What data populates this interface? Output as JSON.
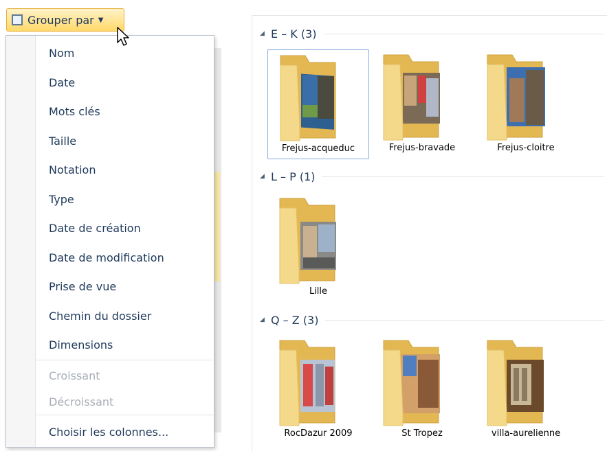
{
  "toolbar": {
    "group_by_label": "Grouper par",
    "group_by_icon": "group-by-icon",
    "dropdown_icon": "chevron-down-icon"
  },
  "menu": {
    "items": [
      {
        "label": "Nom",
        "enabled": true
      },
      {
        "label": "Date",
        "enabled": true
      },
      {
        "label": "Mots clés",
        "enabled": true
      },
      {
        "label": "Taille",
        "enabled": true
      },
      {
        "label": "Notation",
        "enabled": true
      },
      {
        "label": "Type",
        "enabled": true
      },
      {
        "label": "Date de création",
        "enabled": true
      },
      {
        "label": "Date de modification",
        "enabled": true
      },
      {
        "label": "Prise de vue",
        "enabled": true
      },
      {
        "label": "Chemin du dossier",
        "enabled": true
      },
      {
        "label": "Dimensions",
        "enabled": true
      }
    ],
    "order_items": [
      {
        "label": "Croissant",
        "enabled": false
      },
      {
        "label": "Décroissant",
        "enabled": false
      }
    ],
    "choose_columns": "Choisir les colonnes..."
  },
  "groups": [
    {
      "label": "E – K (3)",
      "folders": [
        {
          "name": "Frejus-acqueduc",
          "selected": true,
          "icon": "folder-icon"
        },
        {
          "name": "Frejus-bravade",
          "selected": false,
          "icon": "folder-icon"
        },
        {
          "name": "Frejus-cloitre",
          "selected": false,
          "icon": "folder-icon"
        }
      ]
    },
    {
      "label": "L – P (1)",
      "folders": [
        {
          "name": "Lille",
          "selected": false,
          "icon": "folder-icon"
        }
      ]
    },
    {
      "label": "Q – Z (3)",
      "folders": [
        {
          "name": "RocDazur 2009",
          "selected": false,
          "icon": "folder-icon"
        },
        {
          "name": "St Tropez",
          "selected": false,
          "icon": "folder-icon"
        },
        {
          "name": "villa-aurelienne",
          "selected": false,
          "icon": "folder-icon"
        }
      ]
    }
  ],
  "colors": {
    "accent_button": "#ffd86a",
    "selection_border": "#84acdd",
    "folder_yellow": "#f4d98a",
    "text": "#1e395b",
    "disabled_text": "#a8aeb6"
  }
}
